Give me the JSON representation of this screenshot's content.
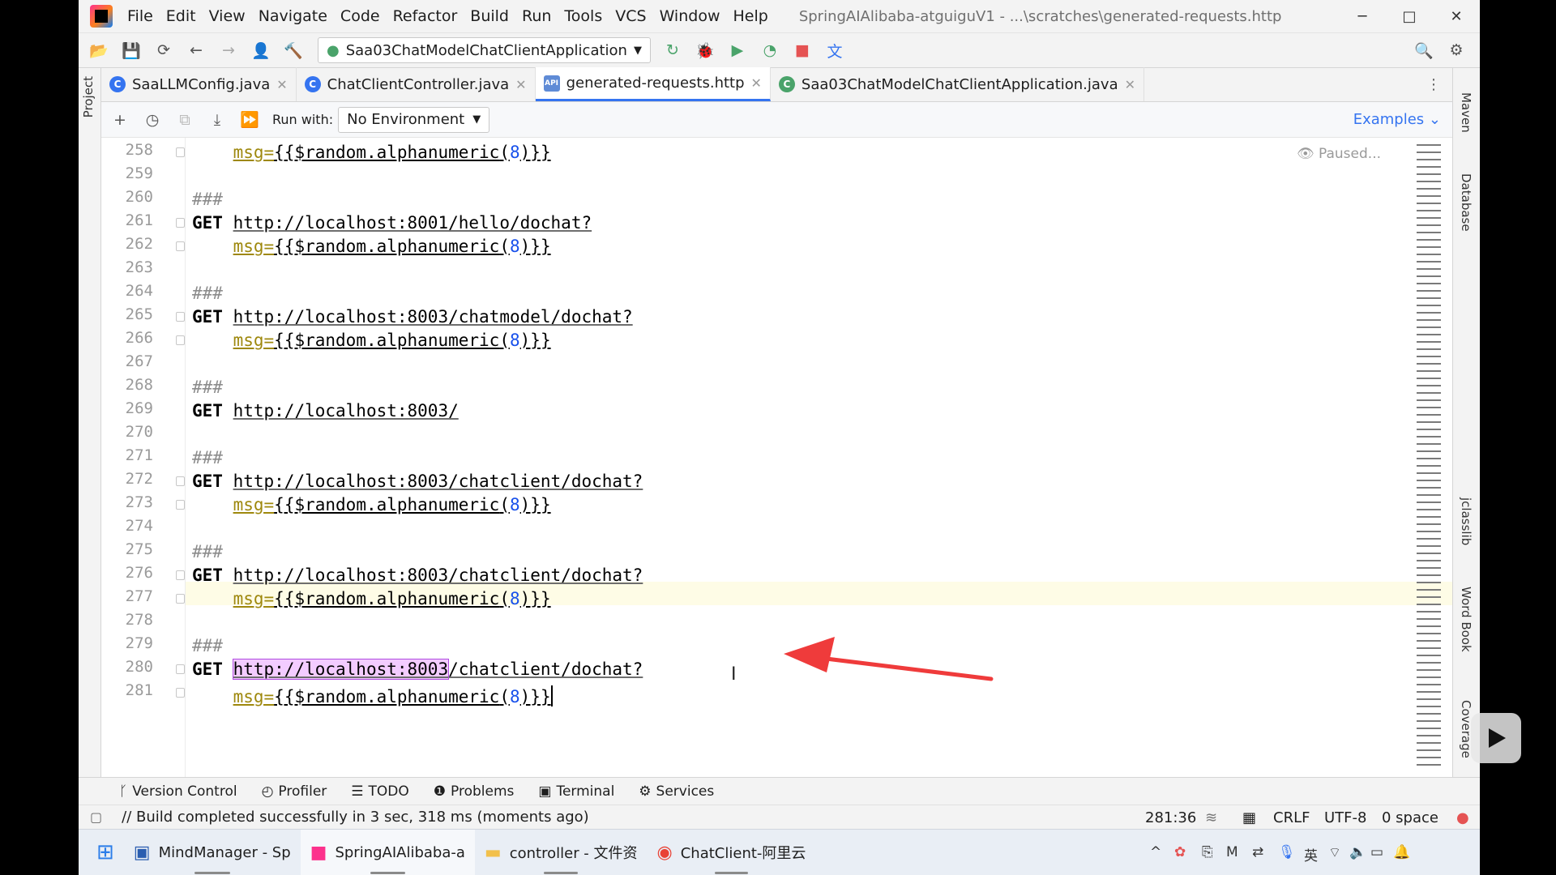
{
  "titlebar": {
    "menus": [
      "File",
      "Edit",
      "View",
      "Navigate",
      "Code",
      "Refactor",
      "Build",
      "Run",
      "Tools",
      "VCS",
      "Window",
      "Help"
    ],
    "window_title": "SpringAIAlibaba-atguiguV1 - ...\\scratches\\generated-requests.http",
    "minimize": "─",
    "maximize": "□",
    "close": "✕"
  },
  "toolbar": {
    "run_config": "Saa03ChatModelChatClientApplication"
  },
  "left_strip": {
    "project_label": "Project"
  },
  "right_strip": {
    "maven": "Maven",
    "database": "Database",
    "jclasslib": "jclasslib",
    "word_book": "Word Book",
    "coverage": "Coverage"
  },
  "tabs": [
    {
      "label": "SaaLLMConfig.java",
      "icon": "C",
      "icon_color": "#3574f0"
    },
    {
      "label": "ChatClientController.java",
      "icon": "C",
      "icon_color": "#3574f0"
    },
    {
      "label": "generated-requests.http",
      "icon": "API",
      "icon_color": "#5f8bd6",
      "active": true
    },
    {
      "label": "Saa03ChatModelChatClientApplication.java",
      "icon": "C",
      "icon_color": "#4aa36a"
    }
  ],
  "httpbar": {
    "run_with_label": "Run with:",
    "environment": "No Environment",
    "examples": "Examples"
  },
  "editor": {
    "paused": "Paused...",
    "line_numbers": [
      "258",
      "259",
      "260",
      "261",
      "262",
      "263",
      "264",
      "265",
      "266",
      "267",
      "268",
      "269",
      "270",
      "271",
      "272",
      "273",
      "274",
      "275",
      "276",
      "277",
      "278",
      "279",
      "280",
      "281"
    ],
    "sep": "###",
    "method": "GET",
    "param_name": "msg",
    "param_eq": "=",
    "param_open": "{{",
    "param_var": "$random.alphanumeric",
    "param_lp": "(",
    "param_num": "8",
    "param_close": ")}}",
    "urls": {
      "hello": "http://localhost:8001/hello/dochat?",
      "chatmodel": "http://localhost:8003/chatmodel/dochat?",
      "root": "http://localhost:8003/",
      "chatclient": "http://localhost:8003/chatclient/dochat?",
      "sel_part": "http://localhost:8003",
      "rest_part": "/chatclient/dochat?"
    }
  },
  "bottom_tools": [
    "Version Control",
    "Profiler",
    "TODO",
    "Problems",
    "Terminal",
    "Services"
  ],
  "status": {
    "message": "// Build completed successfully in 3 sec, 318 ms (moments ago)",
    "position": "281:36",
    "line_sep": "CRLF",
    "encoding": "UTF-8",
    "indent": "0 space"
  },
  "taskbar": {
    "apps": [
      "MindManager - Sp",
      "SpringAIAlibaba-a",
      "controller - 文件资",
      "ChatClient-阿里云"
    ],
    "tray": [
      "^",
      "英"
    ]
  },
  "colors": {
    "accent": "#3574f0",
    "selection": "#f3ccff",
    "arrow": "#ef3b3b"
  }
}
